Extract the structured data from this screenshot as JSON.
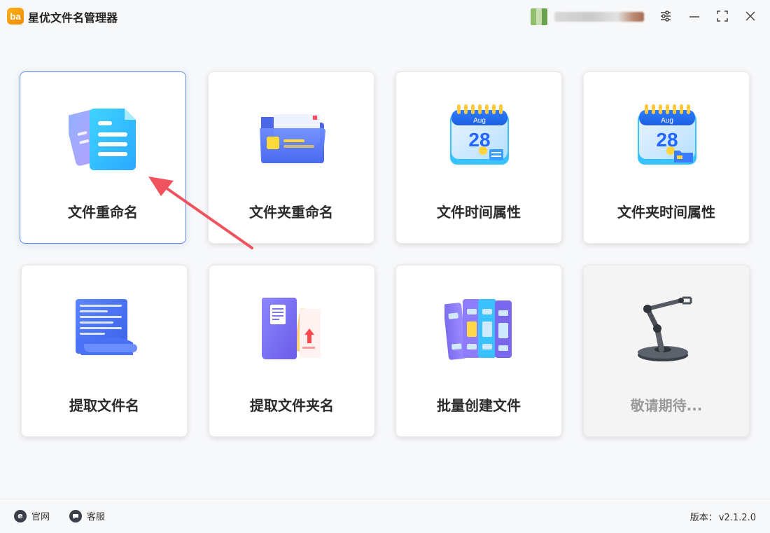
{
  "window": {
    "title": "星优文件名管理器",
    "logo_text": "b a",
    "controls": [
      "settings",
      "minimize",
      "maximize",
      "close"
    ]
  },
  "cards": [
    {
      "label": "文件重命名",
      "icon": "file-documents-icon",
      "selected": true
    },
    {
      "label": "文件夹重命名",
      "icon": "folder-icon"
    },
    {
      "label": "文件时间属性",
      "icon": "calendar-icon",
      "calendar_month": "Aug",
      "calendar_day": "28"
    },
    {
      "label": "文件夹时间属性",
      "icon": "calendar-folder-icon",
      "calendar_month": "Aug",
      "calendar_day": "28"
    },
    {
      "label": "提取文件名",
      "icon": "scroll-document-icon"
    },
    {
      "label": "提取文件夹名",
      "icon": "folder-export-icon"
    },
    {
      "label": "批量创建文件",
      "icon": "binders-icon"
    },
    {
      "label": "敬请期待...",
      "icon": "robot-arm-icon",
      "disabled": true
    }
  ],
  "footer": {
    "website_label": "官网",
    "support_label": "客服",
    "version_label": "版本：",
    "version_value": "v2.1.2.0"
  },
  "colors": {
    "accent": "#5b8def",
    "arrow": "#f0525e"
  }
}
